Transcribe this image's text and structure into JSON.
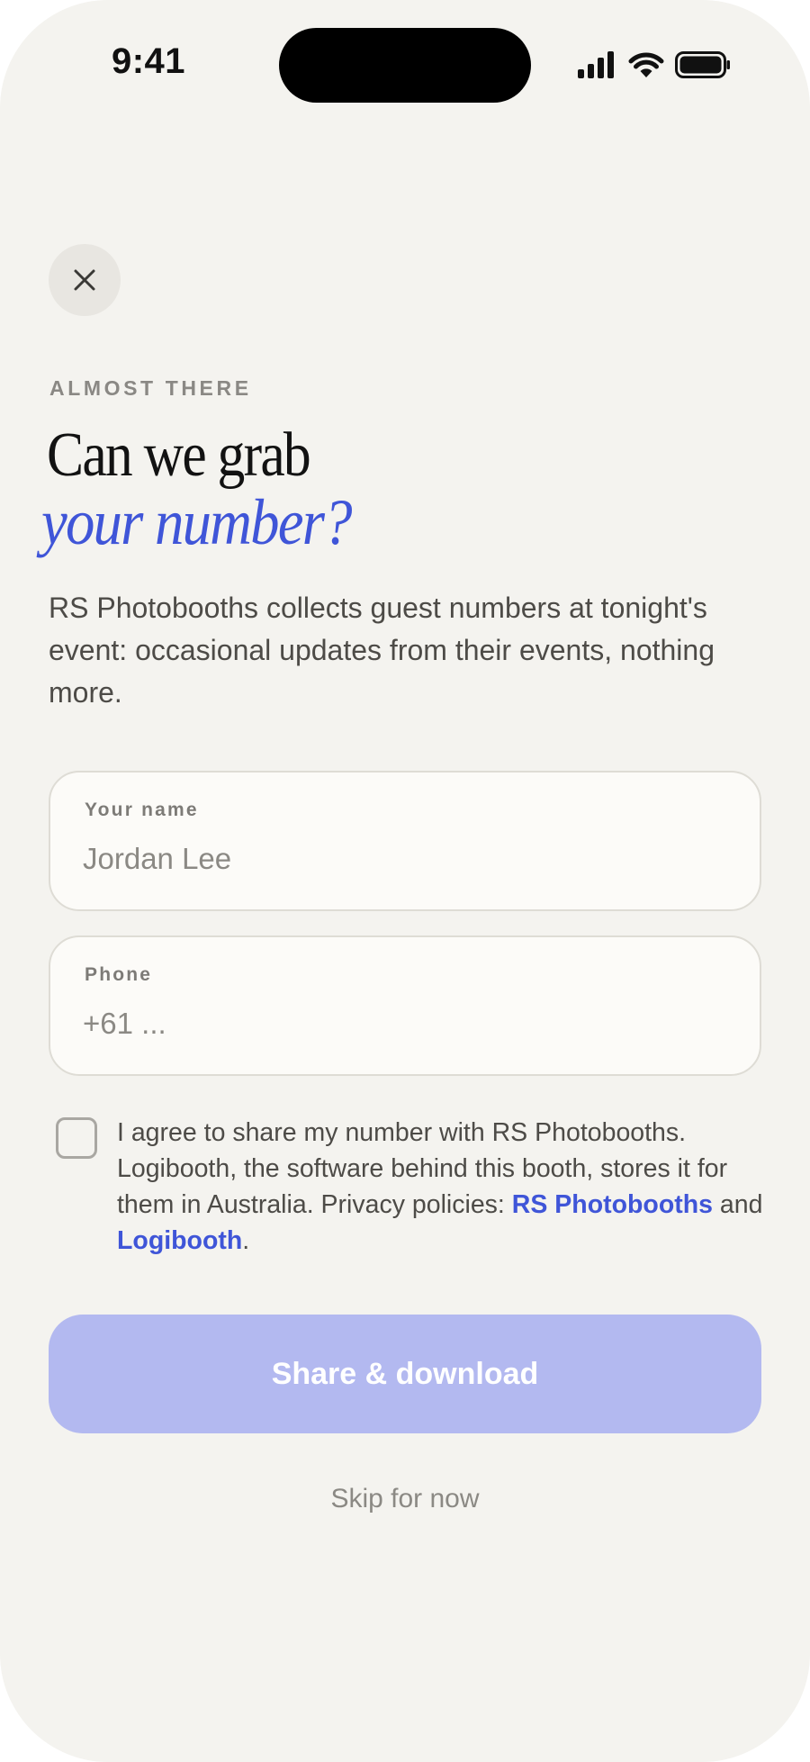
{
  "status_bar": {
    "time": "9:41",
    "icons": [
      "cellular-signal-icon",
      "wifi-icon",
      "battery-icon"
    ]
  },
  "header": {
    "close_icon": "close-icon",
    "eyebrow": "ALMOST THERE",
    "title_line1": "Can we grab",
    "title_line2": "your number?"
  },
  "intro": "RS Photobooths collects guest numbers at tonight's event: occasional updates from their events, nothing more.",
  "form": {
    "name": {
      "label": "Your name",
      "placeholder": "Jordan Lee"
    },
    "phone": {
      "label": "Phone",
      "placeholder": "+61 ..."
    }
  },
  "consent": {
    "checked": false,
    "text_before": "I agree to share my number with RS Photobooths. Logibooth, the software behind this booth, stores it for them in Australia. Privacy policies: ",
    "link1": "RS Photobooths",
    "text_middle": " and ",
    "link2": "Logibooth",
    "text_after": "."
  },
  "actions": {
    "primary_label": "Share & download",
    "skip_label": "Skip for now"
  },
  "colors": {
    "background": "#f4f3ef",
    "accent": "#3f55d8",
    "button_disabled": "#b3b9f0",
    "muted_text": "#8b8984"
  }
}
